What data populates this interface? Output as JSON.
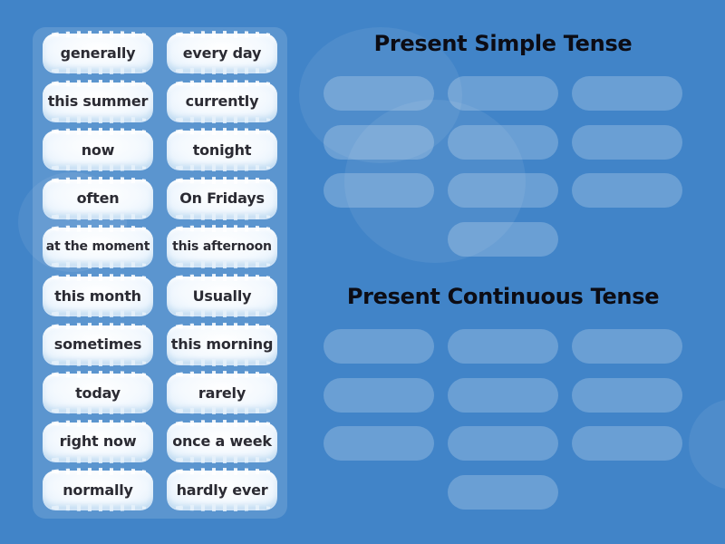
{
  "colors": {
    "background": "#4184c8",
    "card_text": "#2b2b33",
    "heading_text": "#0c0c14",
    "card_face": "#ffffff"
  },
  "word_bank": {
    "cards": [
      {
        "label": "generally"
      },
      {
        "label": "every day"
      },
      {
        "label": "this summer"
      },
      {
        "label": "currently"
      },
      {
        "label": "now"
      },
      {
        "label": "tonight"
      },
      {
        "label": "often"
      },
      {
        "label": "On Fridays"
      },
      {
        "label": "at the moment"
      },
      {
        "label": "this afternoon"
      },
      {
        "label": "this month"
      },
      {
        "label": "Usually"
      },
      {
        "label": "sometimes"
      },
      {
        "label": "this morning"
      },
      {
        "label": "today"
      },
      {
        "label": "rarely"
      },
      {
        "label": "right now"
      },
      {
        "label": "once a week"
      },
      {
        "label": "normally"
      },
      {
        "label": "hardly ever"
      }
    ]
  },
  "groups": [
    {
      "title": "Present Simple Tense",
      "slot_count": 10,
      "filled": 0
    },
    {
      "title": "Present Continuous Tense",
      "slot_count": 10,
      "filled": 0
    }
  ]
}
